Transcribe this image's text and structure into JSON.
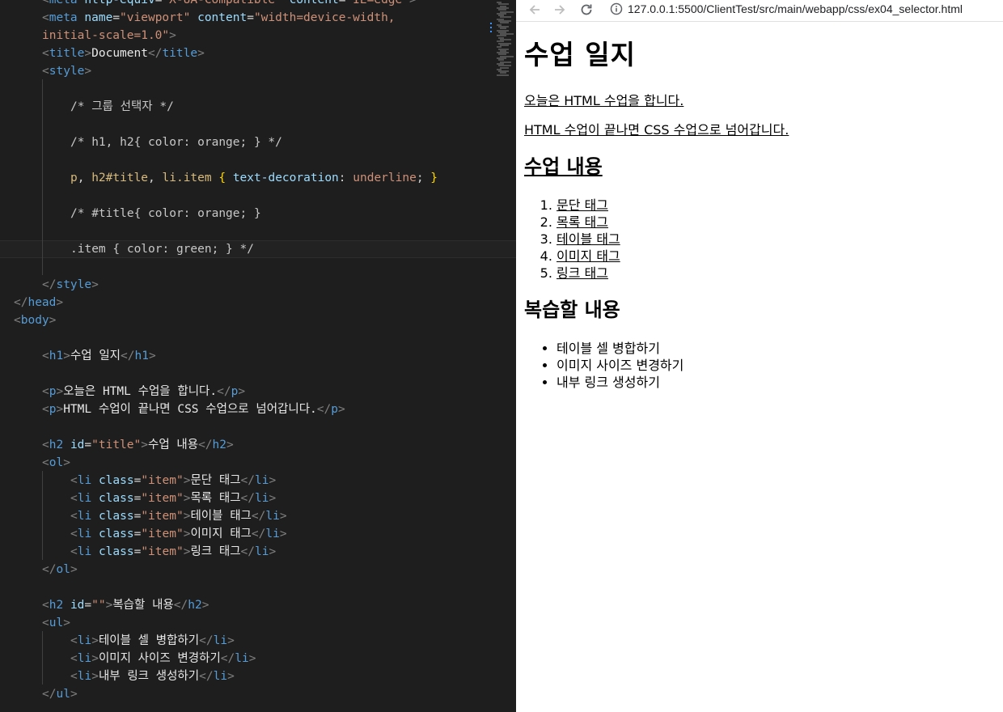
{
  "editor": {
    "lines": [
      {
        "indent": 1,
        "tokens": [
          [
            "t-bracket",
            "<"
          ],
          [
            "t-tag",
            "meta"
          ],
          [
            "t-txt",
            " "
          ],
          [
            "t-attr",
            "http-equiv"
          ],
          [
            "t-txt",
            "="
          ],
          [
            "t-str",
            "\"X-UA-Compatible\""
          ],
          [
            "t-txt",
            " "
          ],
          [
            "t-attr",
            "content"
          ],
          [
            "t-txt",
            "="
          ],
          [
            "t-str",
            "\"IE=edge\""
          ],
          [
            "t-bracket",
            ">"
          ]
        ]
      },
      {
        "indent": 1,
        "tokens": [
          [
            "t-bracket",
            "<"
          ],
          [
            "t-tag",
            "meta"
          ],
          [
            "t-txt",
            " "
          ],
          [
            "t-attr",
            "name"
          ],
          [
            "t-txt",
            "="
          ],
          [
            "t-str",
            "\"viewport\""
          ],
          [
            "t-txt",
            " "
          ],
          [
            "t-attr",
            "content"
          ],
          [
            "t-txt",
            "="
          ],
          [
            "t-str",
            "\"width=device-width,"
          ]
        ]
      },
      {
        "indent": 1,
        "tokens": [
          [
            "t-str",
            "initial-scale=1.0\""
          ],
          [
            "t-bracket",
            ">"
          ]
        ]
      },
      {
        "indent": 1,
        "tokens": [
          [
            "t-bracket",
            "<"
          ],
          [
            "t-tag",
            "title"
          ],
          [
            "t-bracket",
            ">"
          ],
          [
            "t-light",
            "Document"
          ],
          [
            "t-bracket",
            "</"
          ],
          [
            "t-tag",
            "title"
          ],
          [
            "t-bracket",
            ">"
          ]
        ]
      },
      {
        "indent": 1,
        "tokens": [
          [
            "t-bracket",
            "<"
          ],
          [
            "t-tag",
            "style"
          ],
          [
            "t-bracket",
            ">"
          ]
        ]
      },
      {
        "indent": 0,
        "tokens": []
      },
      {
        "indent": 2,
        "tokens": [
          [
            "t-com2",
            "/* 그룹 선택자 */"
          ]
        ]
      },
      {
        "indent": 0,
        "tokens": []
      },
      {
        "indent": 2,
        "tokens": [
          [
            "t-com2",
            "/* h1, h2{ color: orange; } */"
          ]
        ]
      },
      {
        "indent": 0,
        "tokens": []
      },
      {
        "indent": 2,
        "tokens": [
          [
            "t-sel",
            "p"
          ],
          [
            "t-txt",
            ", "
          ],
          [
            "t-sel",
            "h2#title"
          ],
          [
            "t-txt",
            ", "
          ],
          [
            "t-sel",
            "li.item"
          ],
          [
            "t-txt",
            " "
          ],
          [
            "t-brace",
            "{"
          ],
          [
            "t-txt",
            " "
          ],
          [
            "t-prop",
            "text-decoration"
          ],
          [
            "t-txt",
            ": "
          ],
          [
            "t-val",
            "underline"
          ],
          [
            "t-txt",
            "; "
          ],
          [
            "t-brace",
            "}"
          ]
        ]
      },
      {
        "indent": 0,
        "tokens": []
      },
      {
        "indent": 2,
        "tokens": [
          [
            "t-com2",
            "/* #title{ color: orange; }"
          ]
        ]
      },
      {
        "indent": 0,
        "tokens": []
      },
      {
        "indent": 2,
        "tokens": [
          [
            "t-com2",
            ".item { color: green; } */"
          ]
        ],
        "current": true
      },
      {
        "indent": 0,
        "tokens": []
      },
      {
        "indent": 1,
        "tokens": [
          [
            "t-bracket",
            "</"
          ],
          [
            "t-tag",
            "style"
          ],
          [
            "t-bracket",
            ">"
          ]
        ]
      },
      {
        "indent": 0,
        "tokens": [
          [
            "t-bracket",
            "</"
          ],
          [
            "t-tag",
            "head"
          ],
          [
            "t-bracket",
            ">"
          ]
        ]
      },
      {
        "indent": 0,
        "tokens": [
          [
            "t-bracket",
            "<"
          ],
          [
            "t-tag",
            "body"
          ],
          [
            "t-bracket",
            ">"
          ]
        ]
      },
      {
        "indent": 0,
        "tokens": []
      },
      {
        "indent": 1,
        "tokens": [
          [
            "t-bracket",
            "<"
          ],
          [
            "t-tag",
            "h1"
          ],
          [
            "t-bracket",
            ">"
          ],
          [
            "t-light",
            "수업 일지"
          ],
          [
            "t-bracket",
            "</"
          ],
          [
            "t-tag",
            "h1"
          ],
          [
            "t-bracket",
            ">"
          ]
        ]
      },
      {
        "indent": 0,
        "tokens": []
      },
      {
        "indent": 1,
        "tokens": [
          [
            "t-bracket",
            "<"
          ],
          [
            "t-tag",
            "p"
          ],
          [
            "t-bracket",
            ">"
          ],
          [
            "t-light",
            "오늘은 HTML 수업을 합니다."
          ],
          [
            "t-bracket",
            "</"
          ],
          [
            "t-tag",
            "p"
          ],
          [
            "t-bracket",
            ">"
          ]
        ]
      },
      {
        "indent": 1,
        "tokens": [
          [
            "t-bracket",
            "<"
          ],
          [
            "t-tag",
            "p"
          ],
          [
            "t-bracket",
            ">"
          ],
          [
            "t-light",
            "HTML 수업이 끝나면 CSS 수업으로 넘어갑니다."
          ],
          [
            "t-bracket",
            "</"
          ],
          [
            "t-tag",
            "p"
          ],
          [
            "t-bracket",
            ">"
          ]
        ]
      },
      {
        "indent": 0,
        "tokens": []
      },
      {
        "indent": 1,
        "tokens": [
          [
            "t-bracket",
            "<"
          ],
          [
            "t-tag",
            "h2"
          ],
          [
            "t-txt",
            " "
          ],
          [
            "t-attr",
            "id"
          ],
          [
            "t-txt",
            "="
          ],
          [
            "t-str",
            "\"title\""
          ],
          [
            "t-bracket",
            ">"
          ],
          [
            "t-light",
            "수업 내용"
          ],
          [
            "t-bracket",
            "</"
          ],
          [
            "t-tag",
            "h2"
          ],
          [
            "t-bracket",
            ">"
          ]
        ]
      },
      {
        "indent": 1,
        "tokens": [
          [
            "t-bracket",
            "<"
          ],
          [
            "t-tag",
            "ol"
          ],
          [
            "t-bracket",
            ">"
          ]
        ]
      },
      {
        "indent": 2,
        "tokens": [
          [
            "t-bracket",
            "<"
          ],
          [
            "t-tag",
            "li"
          ],
          [
            "t-txt",
            " "
          ],
          [
            "t-attr",
            "class"
          ],
          [
            "t-txt",
            "="
          ],
          [
            "t-str",
            "\"item\""
          ],
          [
            "t-bracket",
            ">"
          ],
          [
            "t-light",
            "문단 태그"
          ],
          [
            "t-bracket",
            "</"
          ],
          [
            "t-tag",
            "li"
          ],
          [
            "t-bracket",
            ">"
          ]
        ]
      },
      {
        "indent": 2,
        "tokens": [
          [
            "t-bracket",
            "<"
          ],
          [
            "t-tag",
            "li"
          ],
          [
            "t-txt",
            " "
          ],
          [
            "t-attr",
            "class"
          ],
          [
            "t-txt",
            "="
          ],
          [
            "t-str",
            "\"item\""
          ],
          [
            "t-bracket",
            ">"
          ],
          [
            "t-light",
            "목록 태그"
          ],
          [
            "t-bracket",
            "</"
          ],
          [
            "t-tag",
            "li"
          ],
          [
            "t-bracket",
            ">"
          ]
        ]
      },
      {
        "indent": 2,
        "tokens": [
          [
            "t-bracket",
            "<"
          ],
          [
            "t-tag",
            "li"
          ],
          [
            "t-txt",
            " "
          ],
          [
            "t-attr",
            "class"
          ],
          [
            "t-txt",
            "="
          ],
          [
            "t-str",
            "\"item\""
          ],
          [
            "t-bracket",
            ">"
          ],
          [
            "t-light",
            "테이블 태그"
          ],
          [
            "t-bracket",
            "</"
          ],
          [
            "t-tag",
            "li"
          ],
          [
            "t-bracket",
            ">"
          ]
        ]
      },
      {
        "indent": 2,
        "tokens": [
          [
            "t-bracket",
            "<"
          ],
          [
            "t-tag",
            "li"
          ],
          [
            "t-txt",
            " "
          ],
          [
            "t-attr",
            "class"
          ],
          [
            "t-txt",
            "="
          ],
          [
            "t-str",
            "\"item\""
          ],
          [
            "t-bracket",
            ">"
          ],
          [
            "t-light",
            "이미지 태그"
          ],
          [
            "t-bracket",
            "</"
          ],
          [
            "t-tag",
            "li"
          ],
          [
            "t-bracket",
            ">"
          ]
        ]
      },
      {
        "indent": 2,
        "tokens": [
          [
            "t-bracket",
            "<"
          ],
          [
            "t-tag",
            "li"
          ],
          [
            "t-txt",
            " "
          ],
          [
            "t-attr",
            "class"
          ],
          [
            "t-txt",
            "="
          ],
          [
            "t-str",
            "\"item\""
          ],
          [
            "t-bracket",
            ">"
          ],
          [
            "t-light",
            "링크 태그"
          ],
          [
            "t-bracket",
            "</"
          ],
          [
            "t-tag",
            "li"
          ],
          [
            "t-bracket",
            ">"
          ]
        ]
      },
      {
        "indent": 1,
        "tokens": [
          [
            "t-bracket",
            "</"
          ],
          [
            "t-tag",
            "ol"
          ],
          [
            "t-bracket",
            ">"
          ]
        ]
      },
      {
        "indent": 0,
        "tokens": []
      },
      {
        "indent": 1,
        "tokens": [
          [
            "t-bracket",
            "<"
          ],
          [
            "t-tag",
            "h2"
          ],
          [
            "t-txt",
            " "
          ],
          [
            "t-attr",
            "id"
          ],
          [
            "t-txt",
            "="
          ],
          [
            "t-str",
            "\"\""
          ],
          [
            "t-bracket",
            ">"
          ],
          [
            "t-light",
            "복습할 내용"
          ],
          [
            "t-bracket",
            "</"
          ],
          [
            "t-tag",
            "h2"
          ],
          [
            "t-bracket",
            ">"
          ]
        ]
      },
      {
        "indent": 1,
        "tokens": [
          [
            "t-bracket",
            "<"
          ],
          [
            "t-tag",
            "ul"
          ],
          [
            "t-bracket",
            ">"
          ]
        ]
      },
      {
        "indent": 2,
        "tokens": [
          [
            "t-bracket",
            "<"
          ],
          [
            "t-tag",
            "li"
          ],
          [
            "t-bracket",
            ">"
          ],
          [
            "t-light",
            "테이블 셀 병합하기"
          ],
          [
            "t-bracket",
            "</"
          ],
          [
            "t-tag",
            "li"
          ],
          [
            "t-bracket",
            ">"
          ]
        ]
      },
      {
        "indent": 2,
        "tokens": [
          [
            "t-bracket",
            "<"
          ],
          [
            "t-tag",
            "li"
          ],
          [
            "t-bracket",
            ">"
          ],
          [
            "t-light",
            "이미지 사이즈 변경하기"
          ],
          [
            "t-bracket",
            "</"
          ],
          [
            "t-tag",
            "li"
          ],
          [
            "t-bracket",
            ">"
          ]
        ]
      },
      {
        "indent": 2,
        "tokens": [
          [
            "t-bracket",
            "<"
          ],
          [
            "t-tag",
            "li"
          ],
          [
            "t-bracket",
            ">"
          ],
          [
            "t-light",
            "내부 링크 생성하기"
          ],
          [
            "t-bracket",
            "</"
          ],
          [
            "t-tag",
            "li"
          ],
          [
            "t-bracket",
            ">"
          ]
        ]
      },
      {
        "indent": 1,
        "tokens": [
          [
            "t-bracket",
            "</"
          ],
          [
            "t-tag",
            "ul"
          ],
          [
            "t-bracket",
            ">"
          ]
        ]
      }
    ]
  },
  "browser": {
    "back_icon": "arrow-left-icon",
    "forward_icon": "arrow-right-icon",
    "reload_icon": "reload-icon",
    "info_icon": "info-icon",
    "url": "127.0.0.1:5500/ClientTest/src/main/webapp/css/ex04_selector.html",
    "page": {
      "h1": "수업 일지",
      "p1": "오늘은 HTML 수업을 합니다.",
      "p2": "HTML 수업이 끝나면 CSS 수업으로 넘어갑니다.",
      "h2_title": "수업 내용",
      "ol_items": [
        "문단 태그",
        "목록 태그",
        "테이블 태그",
        "이미지 태그",
        "링크 태그"
      ],
      "h2_review": "복습할 내용",
      "ul_items": [
        "테이블 셀 병합하기",
        "이미지 사이즈 변경하기",
        "내부 링크 생성하기"
      ]
    }
  },
  "colors": {
    "editor_bg": "#1e1e1e",
    "tag": "#569cd6",
    "attr": "#9cdcfe",
    "string": "#ce9178",
    "selector": "#d7ba7d",
    "brace": "#ffd700"
  }
}
